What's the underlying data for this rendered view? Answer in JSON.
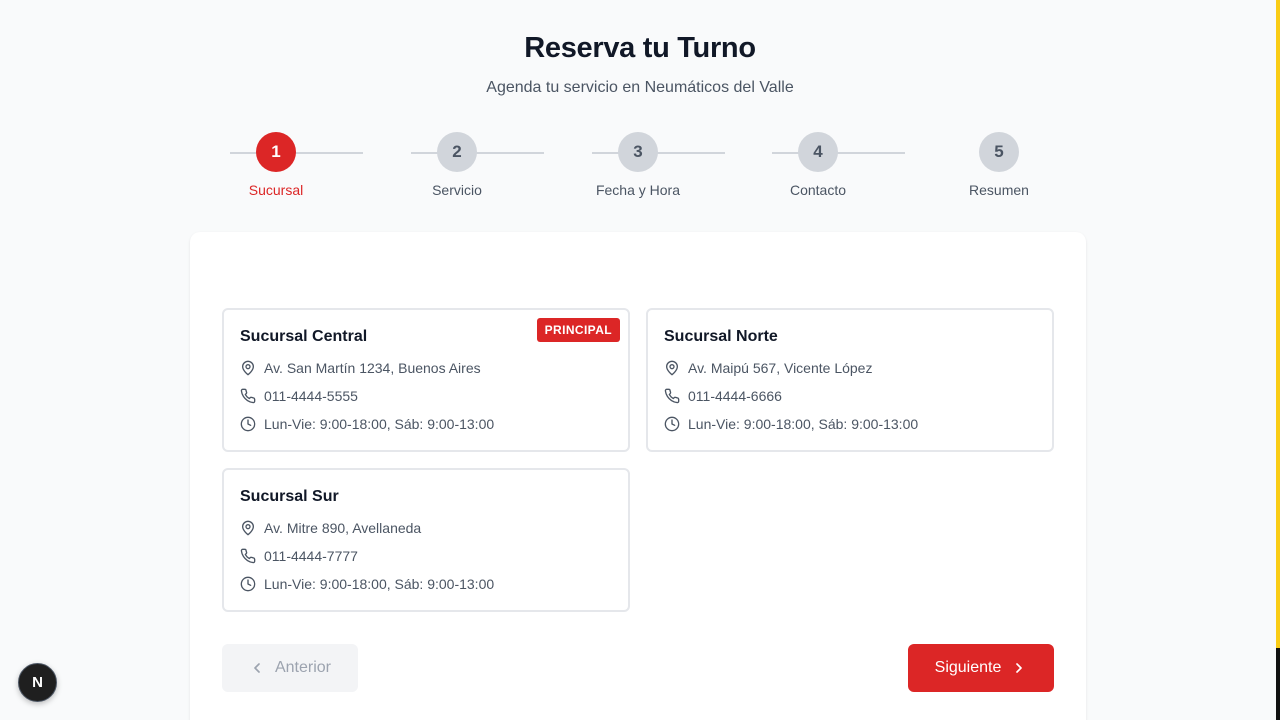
{
  "header": {
    "title": "Reserva tu Turno",
    "subtitle": "Agenda tu servicio en Neumáticos del Valle"
  },
  "steps": [
    {
      "number": "1",
      "label": "Sucursal",
      "active": true
    },
    {
      "number": "2",
      "label": "Servicio",
      "active": false
    },
    {
      "number": "3",
      "label": "Fecha y Hora",
      "active": false
    },
    {
      "number": "4",
      "label": "Contacto",
      "active": false
    },
    {
      "number": "5",
      "label": "Resumen",
      "active": false
    }
  ],
  "branches": [
    {
      "name": "Sucursal Central",
      "badge": "PRINCIPAL",
      "address": "Av. San Martín 1234, Buenos Aires",
      "phone": "011-4444-5555",
      "hours": "Lun-Vie: 9:00-18:00, Sáb: 9:00-13:00"
    },
    {
      "name": "Sucursal Norte",
      "badge": "",
      "address": "Av. Maipú 567, Vicente López",
      "phone": "011-4444-6666",
      "hours": "Lun-Vie: 9:00-18:00, Sáb: 9:00-13:00"
    },
    {
      "name": "Sucursal Sur",
      "badge": "",
      "address": "Av. Mitre 890, Avellaneda",
      "phone": "011-4444-7777",
      "hours": "Lun-Vie: 9:00-18:00, Sáb: 9:00-13:00"
    }
  ],
  "nav": {
    "prev_label": "Anterior",
    "next_label": "Siguiente"
  },
  "dev_badge": {
    "letter": "N"
  },
  "colors": {
    "accent": "#dc2626",
    "step_inactive": "#d1d5db",
    "text_muted": "#4b5563",
    "background": "#f9fafb"
  }
}
